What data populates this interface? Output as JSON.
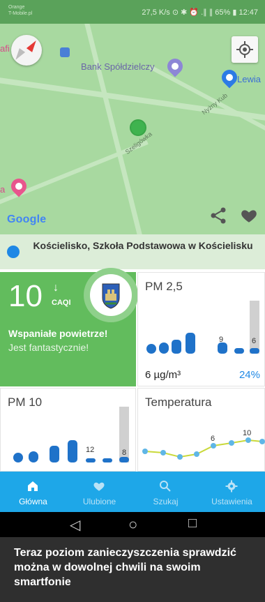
{
  "status_bar": {
    "carrier_line1": "Orange",
    "carrier_line2": "T-Mobile.pl",
    "right_text": "27,5 K/s ⊙ ✱ ⏰ .∥ ∥ 65% ▮ 12:47"
  },
  "map": {
    "poi_bank": "Bank Spółdzielczy",
    "poi_lewia": "Lewia",
    "street_1": "Szeligówka",
    "street_2": "Nyżny Kub",
    "poi_partial_left": "afi",
    "hotel_partial": "a",
    "google_logo": "Google"
  },
  "station": {
    "name": "Kościelisko, Szkoła Podstawowa w Kościelisku"
  },
  "caqi": {
    "value": "10",
    "trend_arrow": "↓",
    "unit": "CAQI",
    "message_main": "Wspaniałe powietrze!",
    "message_sub": "Jest fantastycznie!"
  },
  "pm25": {
    "title": "PM 2,5",
    "bar_labels": [
      "9",
      "6"
    ],
    "value": "6 µg/m³",
    "percent": "24%"
  },
  "pm10": {
    "title": "PM 10",
    "bar_labels": [
      "12",
      "8"
    ]
  },
  "temperature": {
    "title": "Temperatura",
    "labels": [
      "6",
      "10"
    ]
  },
  "nav": {
    "items": [
      {
        "label": "Główna"
      },
      {
        "label": "Ulubione"
      },
      {
        "label": "Szukaj"
      },
      {
        "label": "Ustawienia"
      }
    ]
  },
  "system_nav": {
    "back": "◁",
    "home": "○",
    "recents": "□"
  },
  "caption": {
    "text": "Teraz poziom zanieczyszczenia sprawdzić można w dowolnej chwili na swoim smartfonie"
  },
  "colors": {
    "accent_blue": "#1ea7e8",
    "good_green": "#62bc5d",
    "map_green": "#a8d9a0"
  }
}
